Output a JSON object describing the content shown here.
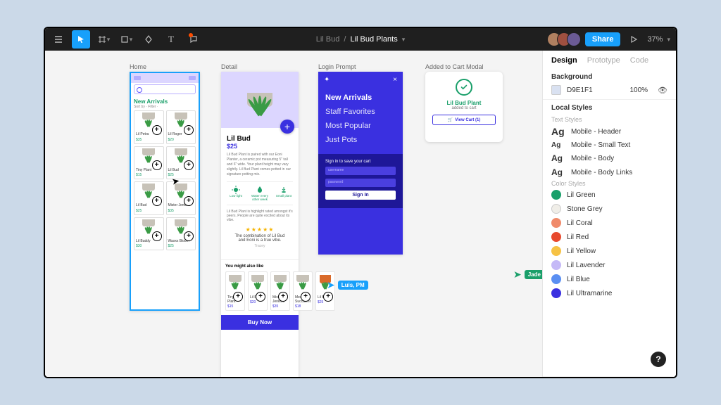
{
  "toolbar": {
    "project": "Lil Bud",
    "file": "Lil Bud Plants",
    "share": "Share",
    "zoom": "37%",
    "avatars": [
      "#b08060",
      "#a05040",
      "#6b5b95"
    ]
  },
  "canvas": {
    "home": {
      "label": "Home",
      "title": "New Arrivals",
      "sub": "Sort by ·  Filter ·",
      "products": [
        {
          "name": "Lil Petra",
          "price": "$35",
          "pot": "g"
        },
        {
          "name": "Lil Roger",
          "price": "$20",
          "pot": "g"
        },
        {
          "name": "Tiny Plant",
          "price": "$15",
          "pot": "g"
        },
        {
          "name": "Lil Bud",
          "price": "$25",
          "pot": "g"
        },
        {
          "name": "Lil Bud",
          "price": "$25",
          "pot": "g"
        },
        {
          "name": "Mister Jenkins",
          "price": "$35",
          "pot": "g"
        },
        {
          "name": "Lil Buddy",
          "price": "$30",
          "pot": "g"
        },
        {
          "name": "Waxxx Bloom",
          "price": "$25",
          "pot": "g"
        }
      ]
    },
    "detail": {
      "label": "Detail",
      "name": "Lil Bud",
      "price": "$25",
      "copy": "Lil Bud Plant is paired with our Eoni Planter, a ceramic pot measuring 5\" tall and 6\" wide. Your plant height may vary slightly. Lil Bud Plant comes potted in our signature potting mix.",
      "care": [
        {
          "t": "Low light"
        },
        {
          "t": "Water every other week"
        },
        {
          "t": "Small plant"
        }
      ],
      "sub": "Lil Bud Plant is highlight rated amongst it's peers. People are quite excited about its vibe.",
      "stars": "★★★★★",
      "quote": "The combination of Lil Bud and Eoni is a true vibe.",
      "byline": "Tracey",
      "rec_title": "You might also like",
      "recs": [
        {
          "name": "Tiny Plant",
          "price": "$15",
          "pot": "g"
        },
        {
          "name": "Lil Roger",
          "price": "$20",
          "pot": "g"
        },
        {
          "name": "Mister Jenkins",
          "price": "$35",
          "pot": "g"
        },
        {
          "name": "Medium Succulent",
          "price": "$18",
          "pot": "g"
        },
        {
          "name": "Lil Bud",
          "price": "$25",
          "pot": "t"
        }
      ],
      "buy": "Buy Now"
    },
    "login": {
      "label": "Login Prompt",
      "close": "×",
      "spark": "✦",
      "nav": [
        "New Arrivals",
        "Staff Favorites",
        "Most Popular",
        "Just Pots"
      ],
      "form_label": "Sign in to save your cart",
      "user_ph": "username",
      "pass_ph": "password",
      "submit": "Sign In"
    },
    "modal": {
      "label": "Added to Cart Modal",
      "name": "Lil Bud Plant",
      "sub": "added to cart",
      "btn": "View Cart (1)"
    },
    "cursors": {
      "luis": {
        "name": "Luis, PM",
        "color": "#18a0fb"
      },
      "jade": {
        "name": "Jade",
        "color": "#1a9f6a"
      }
    }
  },
  "panel": {
    "tabs": [
      "Design",
      "Prototype",
      "Code"
    ],
    "bg": {
      "title": "Background",
      "hex": "D9E1F1",
      "opacity": "100%"
    },
    "localstyles_title": "Local Styles",
    "text_title": "Text Styles",
    "text_styles": [
      {
        "label": "Mobile - Header",
        "size": "big"
      },
      {
        "label": "Mobile - Small Text",
        "size": "sm"
      },
      {
        "label": "Mobile - Body",
        "size": "med"
      },
      {
        "label": "Mobile - Body Links",
        "size": "med"
      }
    ],
    "color_title": "Color Styles",
    "color_styles": [
      {
        "label": "Lil Green",
        "hex": "#1a9f6a"
      },
      {
        "label": "Stone Grey",
        "hex": "#f0eee8"
      },
      {
        "label": "Lil Coral",
        "hex": "#f08a6a"
      },
      {
        "label": "Lil Red",
        "hex": "#e84a2e"
      },
      {
        "label": "Lil Yellow",
        "hex": "#f6c244"
      },
      {
        "label": "Lil Lavender",
        "hex": "#c5b9f7"
      },
      {
        "label": "Lil Blue",
        "hex": "#5a8ff2"
      },
      {
        "label": "Lil Ultramarine",
        "hex": "#3a30e0"
      }
    ]
  },
  "help": "?"
}
